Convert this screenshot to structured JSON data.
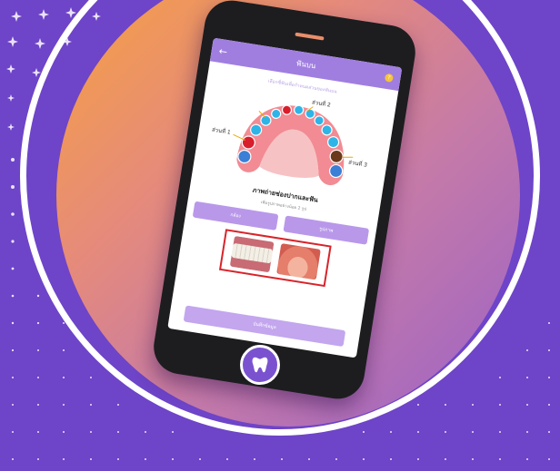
{
  "colors": {
    "background": "#6e44c8",
    "ring": "#ffffff",
    "gradient_start": "#f8a33c",
    "gradient_end": "#9a62c8",
    "app_accent": "#a07ee0",
    "highlight": "#d9232a"
  },
  "app": {
    "title": "ฟันบน",
    "back_icon": "arrow-left-icon",
    "help_badge": "?",
    "instruction": "เลือกซี่ฟันเพื่อกำหนดส่วนของฟันบน",
    "jaw_labels": [
      "ส่วนที่ 1",
      "ส่วนที่ 2",
      "ส่วนที่ 3"
    ],
    "photo_section": {
      "title": "ภาพถ่ายช่องปากและฟัน",
      "subtitle": "เพิ่มรูปภาพอย่างน้อย 2 รูป",
      "tabs": [
        "กล้อง",
        "รูปภาพ"
      ],
      "photos": [
        "front-teeth-photo",
        "upper-palate-photo"
      ]
    },
    "save_label": "บันทึกข้อมูล"
  },
  "badge_icon": "tooth-icon"
}
